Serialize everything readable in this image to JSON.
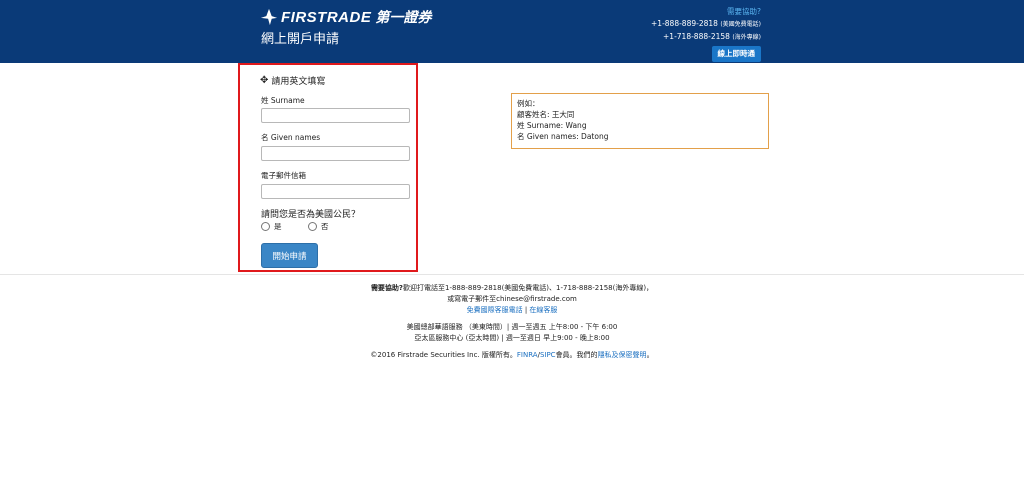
{
  "header": {
    "logo_text": "FIRSTRADE",
    "logo_cn": "第一證券",
    "page_title": "網上開戶申請",
    "help_link": "需要協助?",
    "phone1": "+1-888-889-2818",
    "phone1_note": "(美國免費電話)",
    "phone2": "+1-718-888-2158",
    "phone2_note": "(海外專線)",
    "chat_button": "線上即時通"
  },
  "form": {
    "section_title": "請用英文填寫",
    "surname_label": "姓 Surname",
    "surname_value": "",
    "given_label": "名 Given names",
    "given_value": "",
    "email_label": "電子郵件信箱",
    "email_value": "",
    "citizen_question": "請問您是否為美國公民？",
    "yes_label": "是",
    "no_label": "否",
    "submit_label": "開始申請"
  },
  "example": {
    "line1": "例如：",
    "line2": "顧客姓名: 王大同",
    "line3": "姓 Surname: Wang",
    "line4": "名 Given names: Datong"
  },
  "footer": {
    "help_bold": "需要協助?",
    "help_line1_rest": "歡迎打電話至1-888-889-2818(美國免費電話)、1-718-888-2158(海外專線)，",
    "help_line2": "或寫電子郵件至chinese@firstrade.com",
    "link_free_call": "免費國際客服電話",
    "link_sep": "|",
    "link_online": "在線客服",
    "hours_us": "美國總部華語服務 （美東時間）| 週一至週五 上午8:00 - 下午 6:00",
    "hours_asia": "亞太區服務中心 (亞太時間) | 週一至週日 早上9:00 - 晚上8:00",
    "copyright_pre": "©2016 Firstrade Securities Inc. 版權所有。",
    "finra": "FINRA",
    "slash": "/",
    "sipc": "SIPC",
    "copyright_mid": "會員。我們的",
    "privacy": "隱私及保密聲明",
    "copyright_end": "。"
  }
}
